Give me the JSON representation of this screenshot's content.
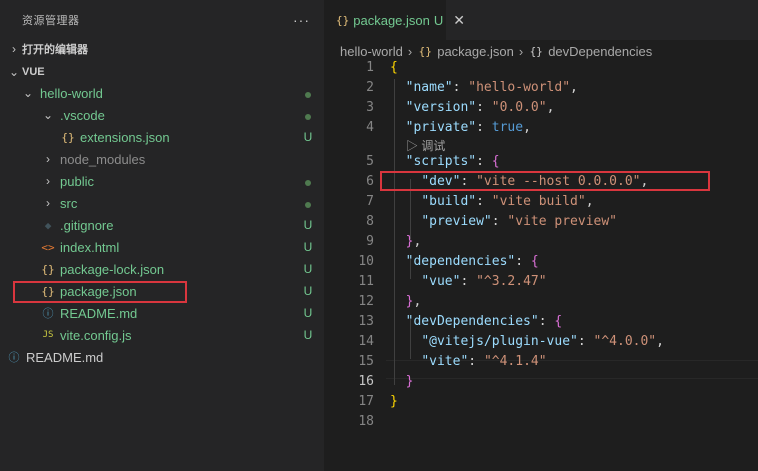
{
  "explorer": {
    "title": "资源管理器",
    "more": "···",
    "open_editors": "打开的编辑器",
    "root": "VUE",
    "items": [
      {
        "label": "hello-world",
        "chev": "v",
        "status": "dot",
        "depth": 1,
        "color": "g"
      },
      {
        "label": ".vscode",
        "chev": "v",
        "status": "dot",
        "depth": 2,
        "color": "g"
      },
      {
        "label": "extensions.json",
        "icon": "{}",
        "status": "U",
        "depth": 3,
        "color": "g"
      },
      {
        "label": "node_modules",
        "chev": ">",
        "status": "",
        "depth": 2,
        "color": "grey"
      },
      {
        "label": "public",
        "chev": ">",
        "status": "dot",
        "depth": 2,
        "color": "g"
      },
      {
        "label": "src",
        "chev": ">",
        "status": "dot",
        "depth": 2,
        "color": "g"
      },
      {
        "label": ".gitignore",
        "icon": "◆",
        "status": "U",
        "depth": 2,
        "color": "g"
      },
      {
        "label": "index.html",
        "icon": "<>",
        "status": "U",
        "depth": 2,
        "color": "g"
      },
      {
        "label": "package-lock.json",
        "icon": "{}",
        "status": "U",
        "depth": 2,
        "color": "g"
      },
      {
        "label": "package.json",
        "icon": "{}",
        "status": "U",
        "depth": 2,
        "color": "g"
      },
      {
        "label": "README.md",
        "icon": "ⓘ",
        "status": "U",
        "depth": 2,
        "color": "g"
      },
      {
        "label": "vite.config.js",
        "icon": "JS",
        "status": "U",
        "depth": 2,
        "color": "g"
      },
      {
        "label": "README.md",
        "icon": "ⓘ",
        "status": "",
        "depth": 0,
        "color": "plain"
      }
    ]
  },
  "tab": {
    "icon": "{}",
    "name": "package.json",
    "status": "U",
    "close": "✕"
  },
  "breadcrumb": {
    "folder": "hello-world",
    "file_icon": "{}",
    "file": "package.json",
    "obj_icon": "{}",
    "obj": "devDependencies"
  },
  "codelens": "▷ 调试",
  "code": {
    "l1": "{",
    "l2k": "\"name\"",
    "l2v": "\"hello-world\"",
    "l3k": "\"version\"",
    "l3v": "\"0.0.0\"",
    "l4k": "\"private\"",
    "l4v": "true",
    "l5k": "\"scripts\"",
    "l5b": "{",
    "l6k": "\"dev\"",
    "l6v": "\"vite --host 0.0.0.0\"",
    "l7k": "\"build\"",
    "l7v": "\"vite build\"",
    "l8k": "\"preview\"",
    "l8v": "\"vite preview\"",
    "l9": "}",
    "l10k": "\"dependencies\"",
    "l10b": "{",
    "l11k": "\"vue\"",
    "l11v": "\"^3.2.47\"",
    "l12": "}",
    "l13k": "\"devDependencies\"",
    "l13b": "{",
    "l14k": "\"@vitejs/plugin-vue\"",
    "l14v": "\"^4.0.0\"",
    "l15k": "\"vite\"",
    "l15v": "\"^4.1.4\"",
    "l16": "}",
    "l17": "}"
  },
  "line_numbers": [
    "1",
    "2",
    "3",
    "4",
    "5",
    "6",
    "7",
    "8",
    "9",
    "10",
    "11",
    "12",
    "13",
    "14",
    "15",
    "16",
    "17",
    "18"
  ],
  "active_line": "16",
  "colors": {
    "modified": "#73c991",
    "highlight": "#d9363e"
  }
}
